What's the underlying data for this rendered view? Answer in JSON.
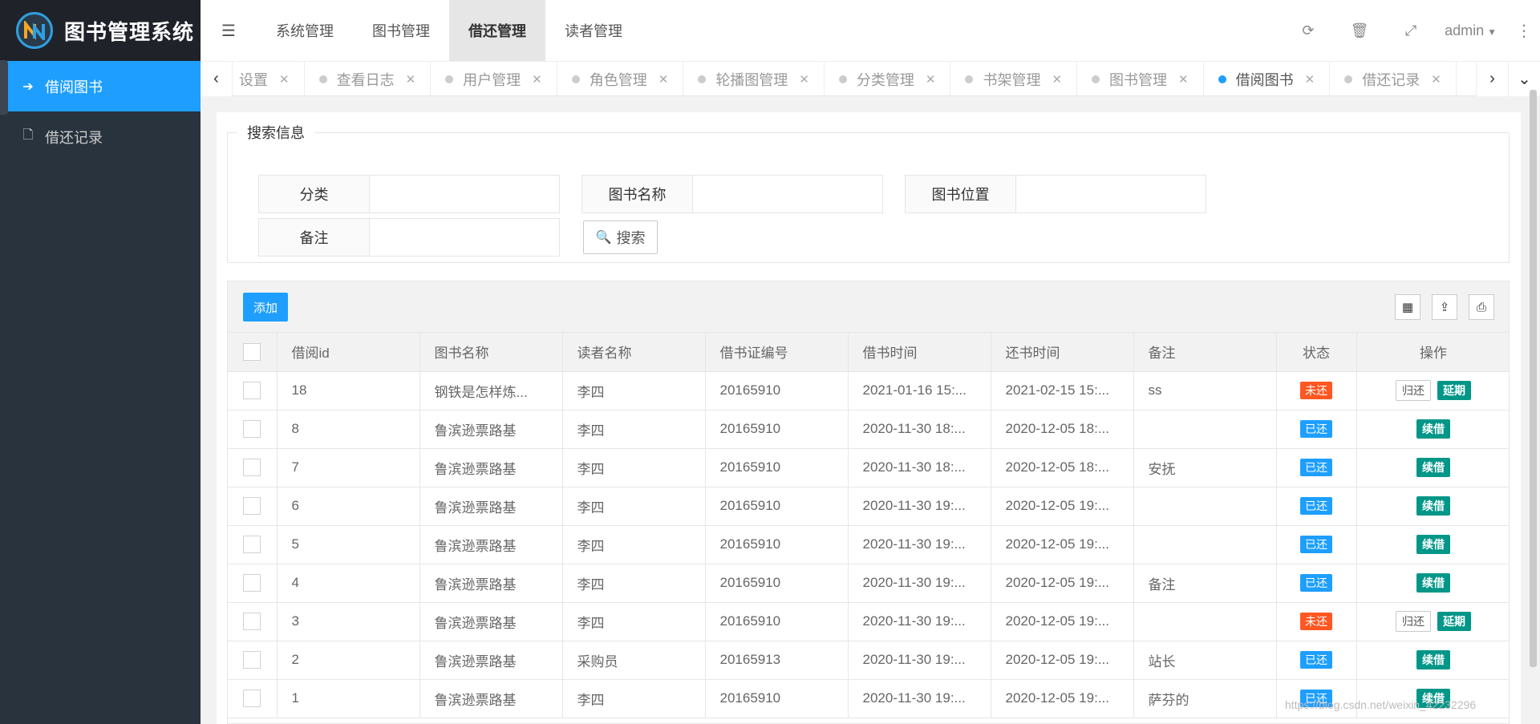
{
  "app": {
    "title": "图书管理系统"
  },
  "sidebar": {
    "items": [
      {
        "label": "借阅图书",
        "icon": "sign-out-icon",
        "active": true
      },
      {
        "label": "借还记录",
        "icon": "file-icon",
        "active": false
      }
    ]
  },
  "topnav": {
    "items": [
      {
        "label": "系统管理",
        "active": false
      },
      {
        "label": "图书管理",
        "active": false
      },
      {
        "label": "借还管理",
        "active": true
      },
      {
        "label": "读者管理",
        "active": false
      }
    ],
    "user": "admin"
  },
  "tabs": [
    {
      "label": "设置",
      "active": false
    },
    {
      "label": "查看日志",
      "active": false
    },
    {
      "label": "用户管理",
      "active": false
    },
    {
      "label": "角色管理",
      "active": false
    },
    {
      "label": "轮播图管理",
      "active": false
    },
    {
      "label": "分类管理",
      "active": false
    },
    {
      "label": "书架管理",
      "active": false
    },
    {
      "label": "图书管理",
      "active": false
    },
    {
      "label": "借阅图书",
      "active": true
    },
    {
      "label": "借还记录",
      "active": false
    }
  ],
  "search": {
    "legend": "搜索信息",
    "category_label": "分类",
    "category_value": "",
    "book_name_label": "图书名称",
    "book_name_value": "",
    "location_label": "图书位置",
    "location_value": "",
    "remark_label": "备注",
    "remark_value": "",
    "search_button": "搜索"
  },
  "table": {
    "add_button": "添加",
    "columns": [
      "借阅id",
      "图书名称",
      "读者名称",
      "借书证编号",
      "借书时间",
      "还书时间",
      "备注",
      "状态",
      "操作"
    ],
    "rows": [
      {
        "id": "18",
        "book": "钢铁是怎样炼...",
        "reader": "李四",
        "card": "20165910",
        "borrow": "2021-01-16 15:...",
        "return": "2021-02-15 15:...",
        "remark": "ss",
        "status": "未还",
        "returned": false
      },
      {
        "id": "8",
        "book": "鲁滨逊票路基",
        "reader": "李四",
        "card": "20165910",
        "borrow": "2020-11-30 18:...",
        "return": "2020-12-05 18:...",
        "remark": "",
        "status": "已还",
        "returned": true
      },
      {
        "id": "7",
        "book": "鲁滨逊票路基",
        "reader": "李四",
        "card": "20165910",
        "borrow": "2020-11-30 18:...",
        "return": "2020-12-05 18:...",
        "remark": "安抚",
        "status": "已还",
        "returned": true
      },
      {
        "id": "6",
        "book": "鲁滨逊票路基",
        "reader": "李四",
        "card": "20165910",
        "borrow": "2020-11-30 19:...",
        "return": "2020-12-05 19:...",
        "remark": "",
        "status": "已还",
        "returned": true
      },
      {
        "id": "5",
        "book": "鲁滨逊票路基",
        "reader": "李四",
        "card": "20165910",
        "borrow": "2020-11-30 19:...",
        "return": "2020-12-05 19:...",
        "remark": "",
        "status": "已还",
        "returned": true
      },
      {
        "id": "4",
        "book": "鲁滨逊票路基",
        "reader": "李四",
        "card": "20165910",
        "borrow": "2020-11-30 19:...",
        "return": "2020-12-05 19:...",
        "remark": "备注",
        "status": "已还",
        "returned": true
      },
      {
        "id": "3",
        "book": "鲁滨逊票路基",
        "reader": "李四",
        "card": "20165910",
        "borrow": "2020-11-30 19:...",
        "return": "2020-12-05 19:...",
        "remark": "",
        "status": "未还",
        "returned": false
      },
      {
        "id": "2",
        "book": "鲁滨逊票路基",
        "reader": "采购员",
        "card": "20165913",
        "borrow": "2020-11-30 19:...",
        "return": "2020-12-05 19:...",
        "remark": "站长",
        "status": "已还",
        "returned": true
      },
      {
        "id": "1",
        "book": "鲁滨逊票路基",
        "reader": "李四",
        "card": "20165910",
        "borrow": "2020-11-30 19:...",
        "return": "2020-12-05 19:...",
        "remark": "萨芬的",
        "status": "已还",
        "returned": true
      }
    ],
    "actions": {
      "return": "归还",
      "extend": "延期",
      "renew": "续借"
    }
  },
  "watermark": "https://blog.csdn.net/weixin_42232296",
  "colors": {
    "sidebar_bg": "#28333e",
    "accent": "#1e9fff",
    "danger": "#ff5722",
    "teal": "#009688"
  }
}
